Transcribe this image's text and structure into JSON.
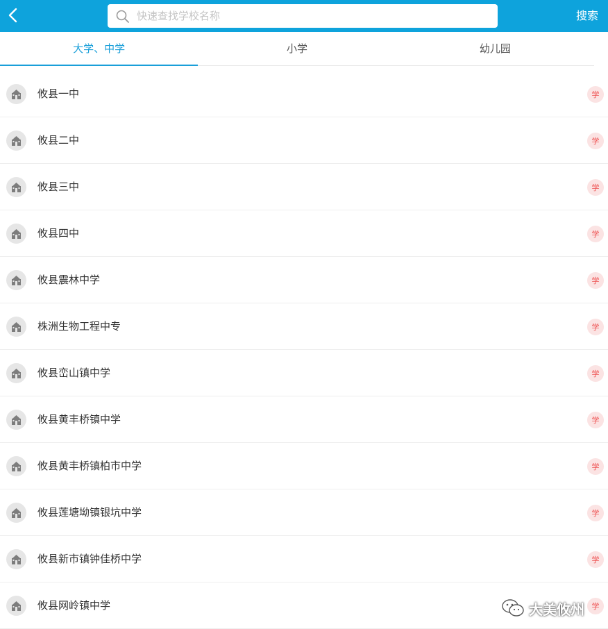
{
  "header": {
    "back_icon": "chevron-left-icon",
    "search_icon": "search-icon",
    "search_placeholder": "快速查找学校名称",
    "search_value": "",
    "search_label": "搜索",
    "background_color": "#0ea3dc"
  },
  "tabs": [
    {
      "label": "大学、中学",
      "active": true
    },
    {
      "label": "小学",
      "active": false
    },
    {
      "label": "幼儿园",
      "active": false
    }
  ],
  "accent_color": "#1a9fd9",
  "schools": [
    {
      "name": "攸县一中",
      "badge": "学"
    },
    {
      "name": "攸县二中",
      "badge": "学"
    },
    {
      "name": "攸县三中",
      "badge": "学"
    },
    {
      "name": "攸县四中",
      "badge": "学"
    },
    {
      "name": "攸县震林中学",
      "badge": "学"
    },
    {
      "name": "株洲生物工程中专",
      "badge": "学"
    },
    {
      "name": "攸县峦山镇中学",
      "badge": "学"
    },
    {
      "name": "攸县黄丰桥镇中学",
      "badge": "学"
    },
    {
      "name": "攸县黄丰桥镇柏市中学",
      "badge": "学"
    },
    {
      "name": "攸县莲塘坳镇银坑中学",
      "badge": "学"
    },
    {
      "name": "攸县新市镇钟佳桥中学",
      "badge": "学"
    },
    {
      "name": "攸县网岭镇中学",
      "badge": "学"
    }
  ],
  "watermark": {
    "text": "大美攸州",
    "icon": "wechat-icon"
  }
}
